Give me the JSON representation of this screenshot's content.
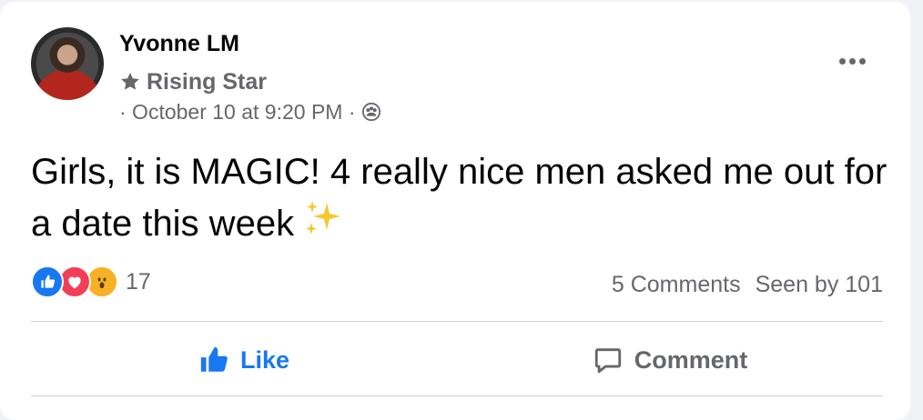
{
  "post": {
    "author": "Yvonne LM",
    "badge": "Rising Star",
    "date": "· October 10 at 9:20 PM ·",
    "text": "Girls, it is MAGIC! 4 really nice men asked me out for a date this week"
  },
  "reactions": {
    "count": "17",
    "types": [
      "like-icon",
      "love-icon",
      "wow-icon"
    ]
  },
  "stats": {
    "comments": "5 Comments",
    "seen": "Seen by 101"
  },
  "actions": {
    "like": "Like",
    "comment": "Comment"
  },
  "colors": {
    "accent": "#1877f2",
    "secondary_text": "#65676b",
    "divider": "#ced0d4"
  }
}
